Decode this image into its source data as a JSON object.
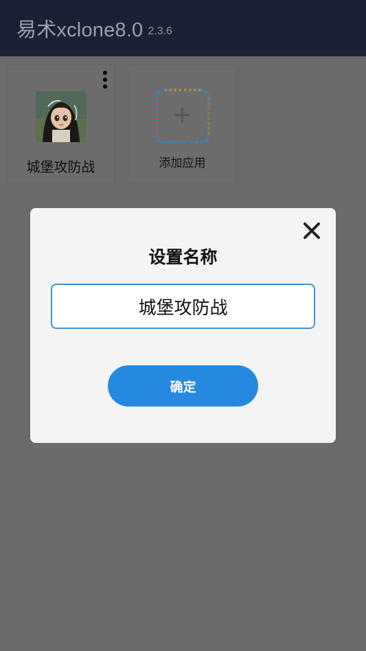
{
  "header": {
    "title": "易术xclone8.0",
    "version": "2.3.6"
  },
  "apps": [
    {
      "label": "城堡攻防战",
      "icon": "game-character-icon"
    }
  ],
  "add_app": {
    "label": "添加应用",
    "icon": "plus-icon"
  },
  "dialog": {
    "title": "设置名称",
    "input_value": "城堡攻防战",
    "confirm_label": "确定",
    "close_icon": "close-icon"
  },
  "colors": {
    "header_bg": "#1a2134",
    "overlay_bg": "#6b6b6b",
    "dialog_bg": "#f4f4f4",
    "accent": "#2589e0",
    "input_border": "#3f93d2"
  }
}
